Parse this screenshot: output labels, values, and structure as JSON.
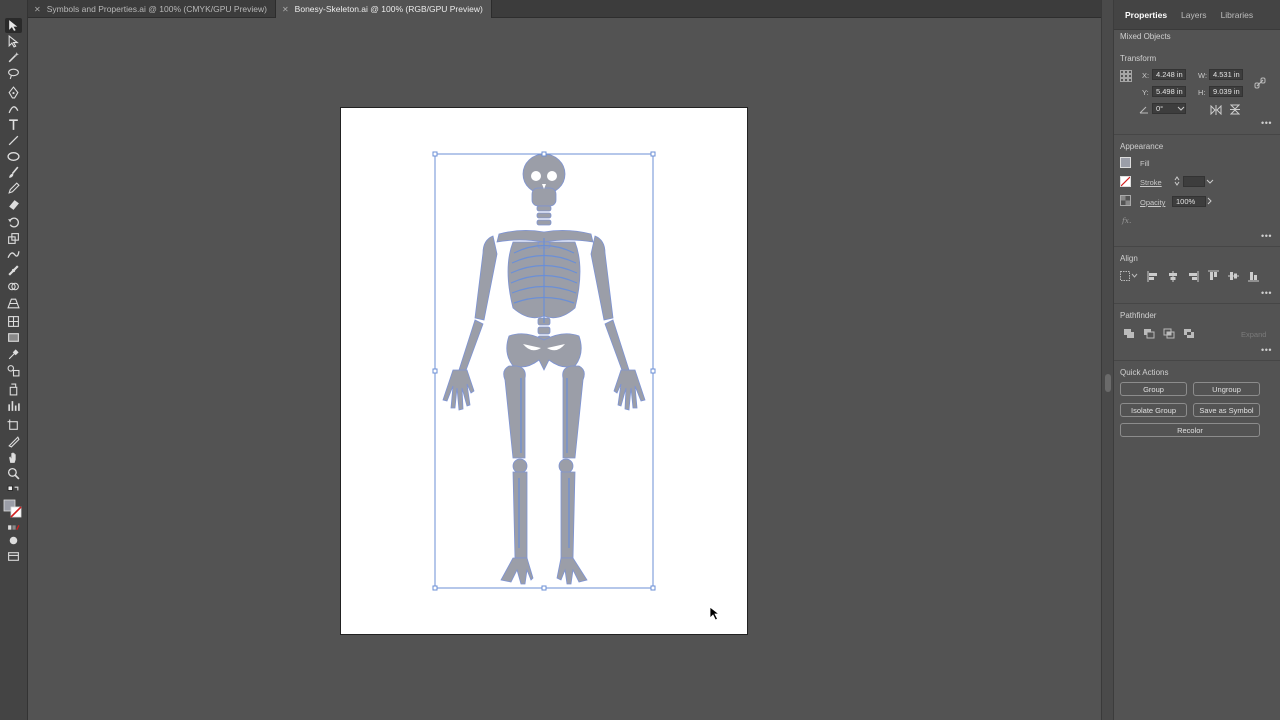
{
  "tabs": [
    {
      "label": "Symbols and Properties.ai @ 100% (CMYK/GPU Preview)",
      "active": false
    },
    {
      "label": "Bonesy-Skeleton.ai @ 100% (RGB/GPU Preview)",
      "active": true
    }
  ],
  "panel": {
    "tabs": [
      "Properties",
      "Layers",
      "Libraries"
    ],
    "selection_type": "Mixed Objects",
    "transform": {
      "title": "Transform",
      "x_label": "X:",
      "x_value": "4.248 in",
      "y_label": "Y:",
      "y_value": "5.498 in",
      "w_label": "W:",
      "w_value": "4.531 in",
      "h_label": "H:",
      "h_value": "9.039 in",
      "angle_value": "0°"
    },
    "appearance": {
      "title": "Appearance",
      "fill_label": "Fill",
      "stroke_label": "Stroke",
      "opacity_label": "Opacity",
      "opacity_value": "100%",
      "fx_label": "fx."
    },
    "align": {
      "title": "Align"
    },
    "pathfinder": {
      "title": "Pathfinder",
      "expand_label": "Expand"
    },
    "quick_actions": {
      "title": "Quick Actions",
      "group": "Group",
      "ungroup": "Ungroup",
      "isolate_group": "Isolate Group",
      "save_as_symbol": "Save as Symbol",
      "recolor": "Recolor"
    },
    "more_glyph": "•••"
  },
  "colors": {
    "bone": "#9b9ea8",
    "selection": "#6b8fd6",
    "panel_bg": "#535353"
  }
}
